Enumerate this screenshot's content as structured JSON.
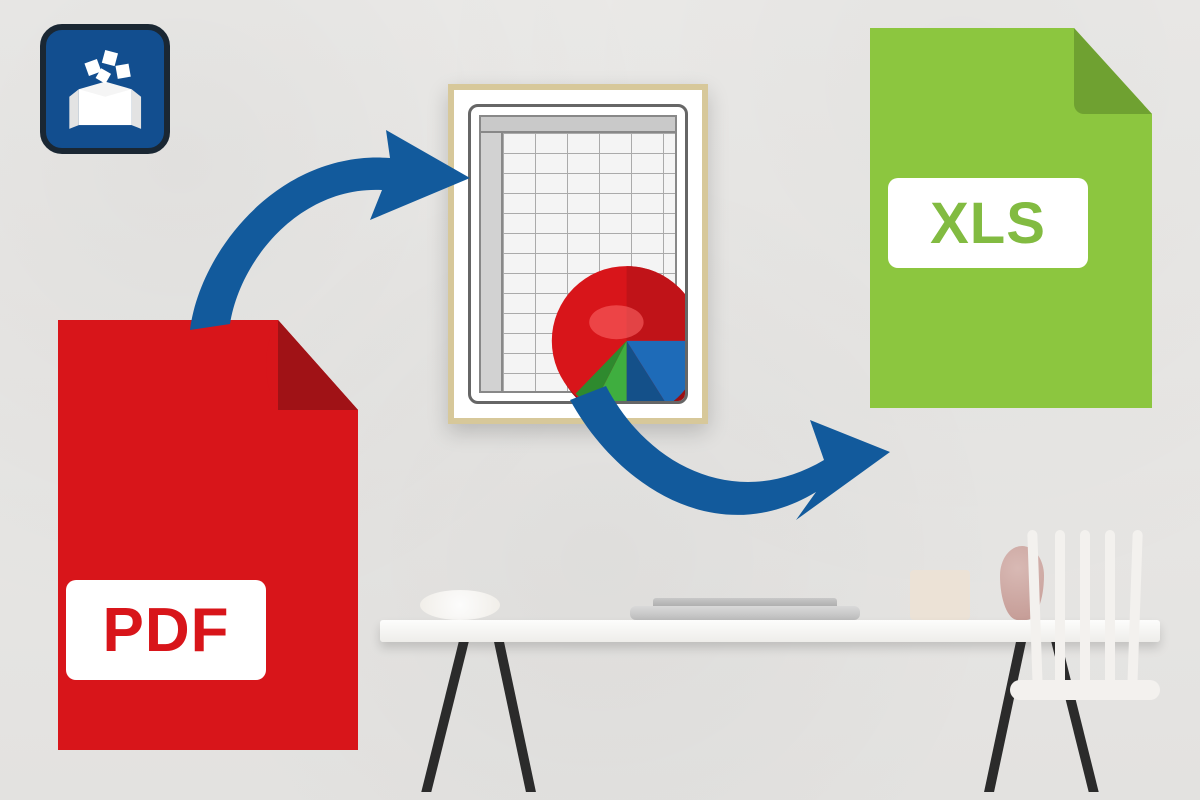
{
  "diagram": {
    "source_format_label": "PDF",
    "target_format_label": "XLS"
  },
  "colors": {
    "pdf": "#d8151a",
    "pdf_fold": "#a01216",
    "xls": "#8cc63f",
    "xls_fold": "#6fa131",
    "arrow": "#125a9c",
    "logo_bg": "#124e8f",
    "logo_border": "#1a2733"
  },
  "icons": {
    "app_logo": "box-with-papers-icon",
    "source": "pdf-file-icon",
    "intermediate": "spreadsheet-with-pie-chart-icon",
    "target": "xls-file-icon",
    "arrow1": "curved-arrow-icon",
    "arrow2": "curved-arrow-icon"
  }
}
